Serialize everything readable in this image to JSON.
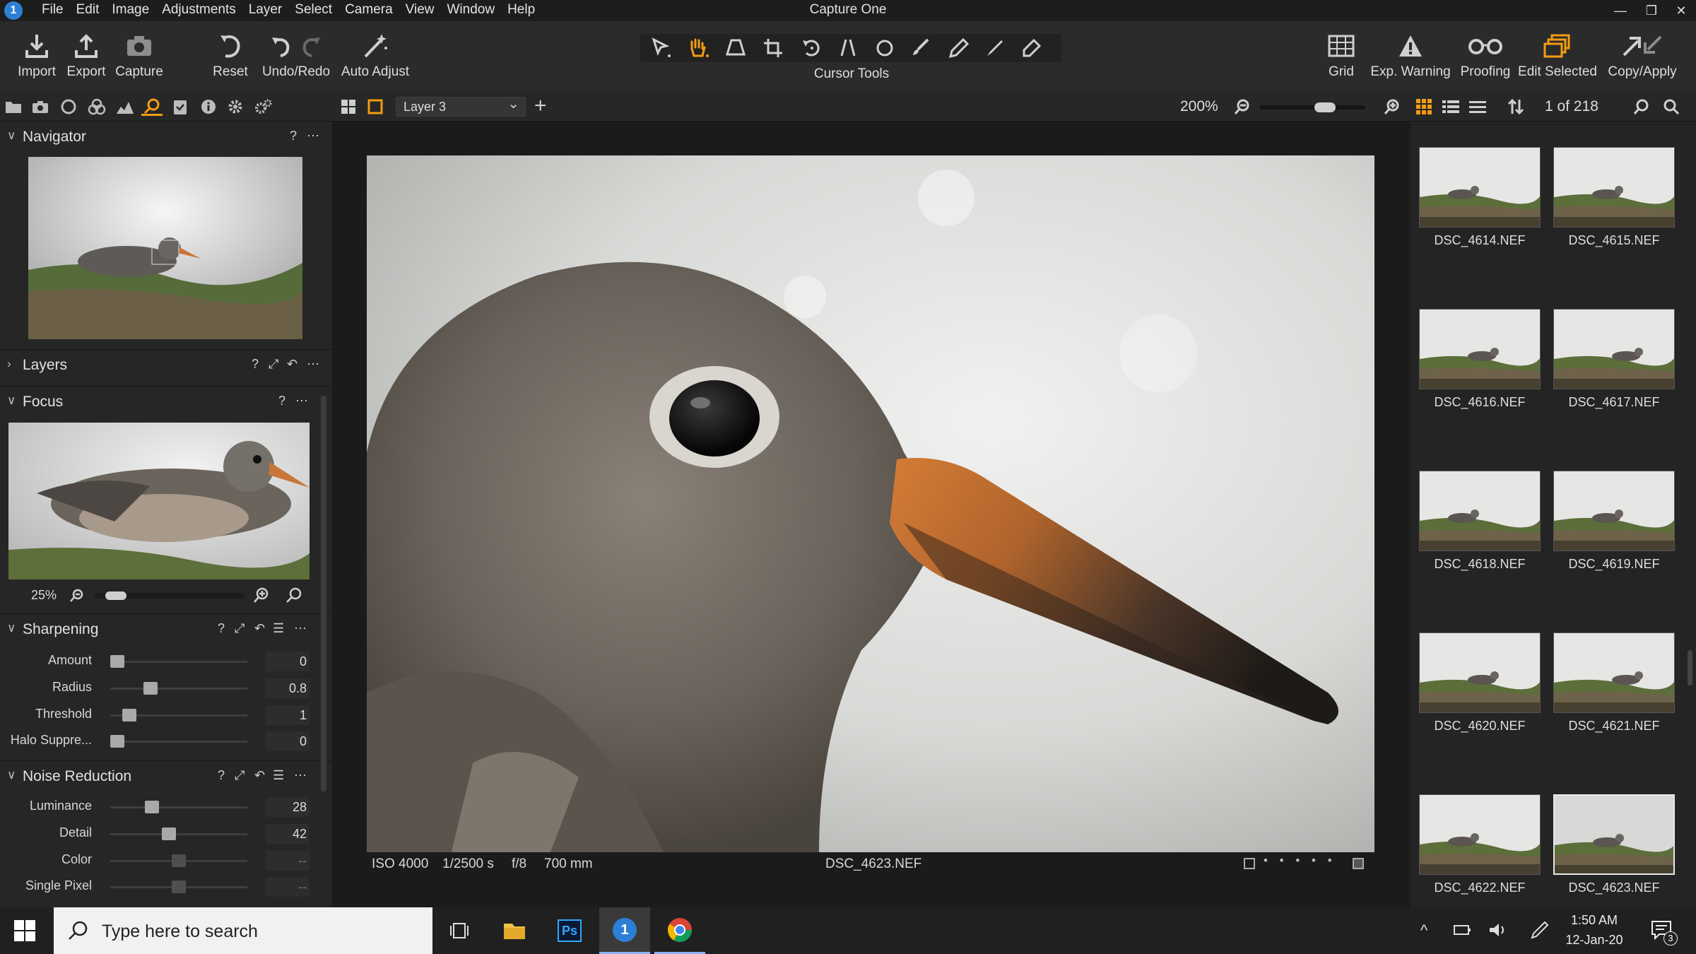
{
  "app": {
    "title": "Capture One",
    "logo_glyph": "1",
    "logo_color": "#2d7fd6",
    "accent": "#f39c12"
  },
  "menu": [
    "File",
    "Edit",
    "Image",
    "Adjustments",
    "Layer",
    "Select",
    "Camera",
    "View",
    "Window",
    "Help"
  ],
  "window_controls": {
    "minimize": "—",
    "maximize": "❐",
    "close": "✕"
  },
  "toolbar": {
    "left": [
      {
        "label": "Import",
        "icon": "import-icon"
      },
      {
        "label": "Export",
        "icon": "export-icon"
      },
      {
        "label": "Capture",
        "icon": "camera-icon"
      },
      {
        "label": "Reset",
        "icon": "reset-icon"
      },
      {
        "label": "Undo/Redo",
        "icon": "undo-redo-icon"
      },
      {
        "label": "Auto Adjust",
        "icon": "auto-adjust-icon"
      }
    ],
    "cursor_tools_label": "Cursor Tools",
    "cursor_tools": [
      "select-cursor-icon",
      "pan-hand-icon",
      "perspective-icon",
      "crop-icon",
      "rotate-icon",
      "straighten-icon",
      "circle-mask-icon",
      "brush-icon",
      "pen-icon",
      "draw-mask-icon",
      "eraser-icon"
    ],
    "right": [
      {
        "label": "Grid",
        "icon": "grid-icon"
      },
      {
        "label": "Exp. Warning",
        "icon": "warning-icon"
      },
      {
        "label": "Proofing",
        "icon": "glasses-icon"
      },
      {
        "label": "Edit Selected",
        "icon": "edit-selected-icon"
      },
      {
        "label": "Copy/Apply",
        "icon": "copy-apply-icon"
      }
    ]
  },
  "secondary_bar": {
    "layer_select": "Layer 3",
    "layer_chevron": "⌄",
    "add_layer": "+",
    "zoom": "200%",
    "zoom_slider_value": 0.65,
    "count": "1 of 218"
  },
  "panels": {
    "navigator": {
      "title": "Navigator",
      "help": "?",
      "more": "⋯"
    },
    "layers": {
      "title": "Layers",
      "help": "?",
      "more": "⋯"
    },
    "focus": {
      "title": "Focus",
      "help": "?",
      "more": "⋯",
      "zoom": "25%",
      "zoom_slider_value": 0.08
    },
    "sharpening": {
      "title": "Sharpening",
      "help": "?",
      "more": "⋯",
      "sliders": [
        {
          "label": "Amount",
          "value": "0",
          "level": 0.0
        },
        {
          "label": "Radius",
          "value": "0.8",
          "level": 0.27
        },
        {
          "label": "Threshold",
          "value": "1",
          "level": 0.1
        },
        {
          "label": "Halo Suppre...",
          "value": "0",
          "level": 0.0
        }
      ]
    },
    "noise_reduction": {
      "title": "Noise Reduction",
      "help": "?",
      "more": "⋯",
      "sliders": [
        {
          "label": "Luminance",
          "value": "28",
          "level": 0.28,
          "dim": false
        },
        {
          "label": "Detail",
          "value": "42",
          "level": 0.42,
          "dim": false
        },
        {
          "label": "Color",
          "value": "--",
          "level": 0.5,
          "dim": true
        },
        {
          "label": "Single Pixel",
          "value": "--",
          "level": 0.5,
          "dim": true
        }
      ]
    }
  },
  "viewer": {
    "meta": {
      "iso": "ISO 4000",
      "shutter": "1/2500 s",
      "aperture": "f/8",
      "focal": "700 mm",
      "filename": "DSC_4623.NEF"
    },
    "rating_dots": "• • • • •"
  },
  "browser": {
    "thumbnails": [
      {
        "name": "DSC_4614.NEF",
        "selected": false
      },
      {
        "name": "DSC_4615.NEF",
        "selected": false
      },
      {
        "name": "DSC_4616.NEF",
        "selected": false
      },
      {
        "name": "DSC_4617.NEF",
        "selected": false
      },
      {
        "name": "DSC_4618.NEF",
        "selected": false
      },
      {
        "name": "DSC_4619.NEF",
        "selected": false
      },
      {
        "name": "DSC_4620.NEF",
        "selected": false
      },
      {
        "name": "DSC_4621.NEF",
        "selected": false
      },
      {
        "name": "DSC_4622.NEF",
        "selected": false
      },
      {
        "name": "DSC_4623.NEF",
        "selected": true
      }
    ]
  },
  "taskbar": {
    "search_placeholder": "Type here to search",
    "apps": [
      "task-view-icon",
      "file-explorer-icon",
      "photoshop-icon",
      "capture-one-icon",
      "chrome-icon"
    ],
    "photoshop_label": "Ps",
    "time": "1:50 AM",
    "date": "12-Jan-20",
    "notification_count": "3"
  }
}
